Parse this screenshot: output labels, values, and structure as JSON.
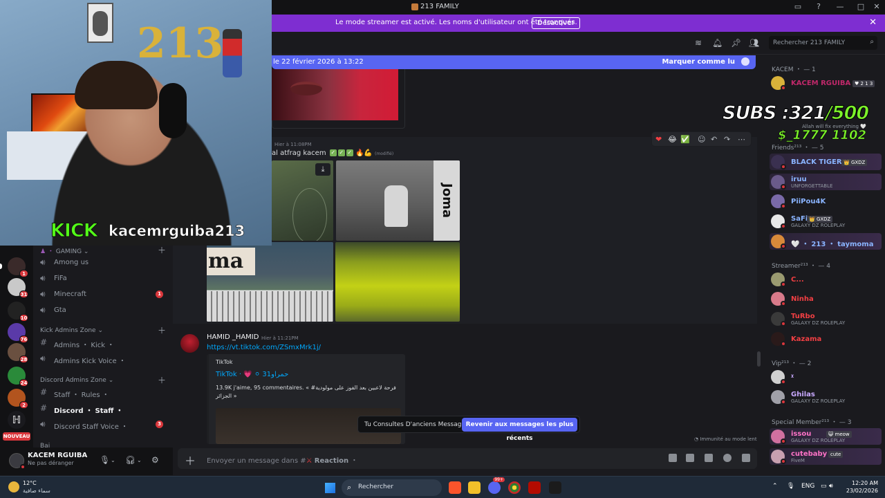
{
  "window": {
    "title": "213 FAMILY"
  },
  "banner": {
    "text": "Le mode streamer est activé. Les noms d'utilisateur ont été tronqués.",
    "button": "Désactiver"
  },
  "header": {
    "search_placeholder": "Rechercher 213 FAMILY"
  },
  "new_messages": {
    "since": "le 22 février 2026 à 13:22",
    "mark_read": "Marquer comme lu"
  },
  "webcam": {
    "platform": "KICK",
    "username": "kacemrguiba213",
    "balloons": "213"
  },
  "overlay": {
    "subs_label": "SUBS :",
    "subs_current": "321",
    "subs_goal": "/500",
    "subs_line2": "$_1777 1102"
  },
  "servers": [
    {
      "badge": "1",
      "color": "#3a2a2a"
    },
    {
      "badge": "31",
      "color": "#c9c9c9"
    },
    {
      "badge": "10",
      "color": "#222"
    },
    {
      "badge": "76",
      "color": "#5a3aa8"
    },
    {
      "badge": "28",
      "color": "#6a5040"
    },
    {
      "badge": "24",
      "color": "#2a8a3a"
    },
    {
      "badge": "2",
      "color": "#b2541e"
    },
    {
      "badge": "",
      "color": "#1a1a1e"
    }
  ],
  "nouveau_label": "NOUVEAU",
  "channels": {
    "gaming_cat": "GAMING",
    "gaming": [
      {
        "name": "Among us",
        "badge": ""
      },
      {
        "name": "FiFa",
        "badge": ""
      },
      {
        "name": "Minecraft",
        "badge": "1"
      },
      {
        "name": "Gta",
        "badge": ""
      }
    ],
    "kick_cat": "Kick Admins Zone",
    "kick": [
      {
        "name": "Admins ・ Kick ・",
        "badge": ""
      },
      {
        "name": "Admins Kick Voice ・",
        "badge": ""
      }
    ],
    "discord_cat": "Discord Admins Zone",
    "discord": [
      {
        "name": "Staff ・ Rules ・",
        "badge": ""
      },
      {
        "name": "Discord ・ Staff ・",
        "badge": ""
      },
      {
        "name": "Discord Staff Voice ・",
        "badge": "3"
      }
    ],
    "truncated_cat": "Bai"
  },
  "user": {
    "name": "KACEM RGUIBA",
    "status": "Ne pas déranger"
  },
  "messages": {
    "first": {
      "time": "Hier à 11:08PM",
      "text": "al atfrag  kacem",
      "edited": "(modifié)"
    },
    "hamid": {
      "author": "HAMID _HAMID",
      "time": "Hier à 11:21PM",
      "link": "https://vt.tiktok.com/ZSmxMrk1j/",
      "embed_provider": "TikTok",
      "embed_title": "TikTok · 💗 ⚪ حمراو31",
      "embed_desc": "13.9K j'aime, 95 commentaires. « فرحة لاعبين بعد الفوز على مولودية# الجزائر »"
    },
    "tile_text": "ma",
    "tile_brand": "Joma"
  },
  "old_messages": {
    "label": "Tu Consultes D'anciens Messages",
    "button": "Revenir aux messages les plus récents"
  },
  "slowmode": "Immunité au mode lent",
  "composer": {
    "placeholder_prefix": "Envoyer un message dans #",
    "channel": "Reaction",
    "suffix": "・"
  },
  "members": {
    "groups": [
      {
        "label": "KACEM ・ — 1"
      },
      {
        "label": "Friends²¹³ ・ — 5"
      },
      {
        "label": "Streamer²¹³ ・ — 4"
      },
      {
        "label": "Vip²¹³ ・ — 2"
      },
      {
        "label": "Special Member²¹³ ・ — 3"
      }
    ],
    "kacem": [
      {
        "name": "KACEM RGUIBA",
        "tag": "♥ 2 1 3",
        "sub": "",
        "color": "#c0286a"
      }
    ],
    "kacem_status": "Allah will fix everything 🤍",
    "friends": [
      {
        "name": "BLACK TIGER",
        "tag": "👑 GXDZ",
        "sub": "",
        "color": "#8ab4ff"
      },
      {
        "name": "iruu",
        "tag": "",
        "sub": "UNFORGETTABLE",
        "color": "#8ab4ff"
      },
      {
        "name": "PiiPou4K",
        "tag": "",
        "sub": "",
        "color": "#8ab4ff"
      },
      {
        "name": "SaFi",
        "tag": "👑 GXDZ",
        "sub": "GALAXY DZ ROLEPLAY",
        "color": "#8ab4ff"
      },
      {
        "name": "🤍 ・ 213 ・ taymoma",
        "tag": "",
        "sub": "",
        "color": "#8ab4ff"
      }
    ],
    "streamers": [
      {
        "name": "C...",
        "sub": "",
        "color": "#f23f43"
      },
      {
        "name": "Ninha",
        "sub": "",
        "color": "#f23f43"
      },
      {
        "name": "TuRbo",
        "sub": "GALAXY DZ ROLEPLAY",
        "color": "#f23f43"
      },
      {
        "name": "Kazama",
        "sub": "",
        "color": "#f23f43"
      }
    ],
    "vips": [
      {
        "name": "ᵡ",
        "sub": "",
        "color": "#c9a9ff"
      },
      {
        "name": "Ghilas",
        "sub": "GALAXY DZ ROLEPLAY",
        "color": "#c9a9ff"
      }
    ],
    "specials": [
      {
        "name": "issou",
        "tag": "😺 meow",
        "sub": "GALAXY DZ ROLEPLAY",
        "color": "#ff73c7"
      },
      {
        "name": "cutebaby",
        "tag": "cute",
        "sub": "FiveM",
        "color": "#ff73c7"
      }
    ]
  },
  "taskbar": {
    "temp": "12°C",
    "condition": "سماء صافية",
    "search": "Rechercher",
    "lang": "ENG",
    "time": "12:20 AM",
    "date": "23/02/2026",
    "discord_badge": "99+"
  }
}
